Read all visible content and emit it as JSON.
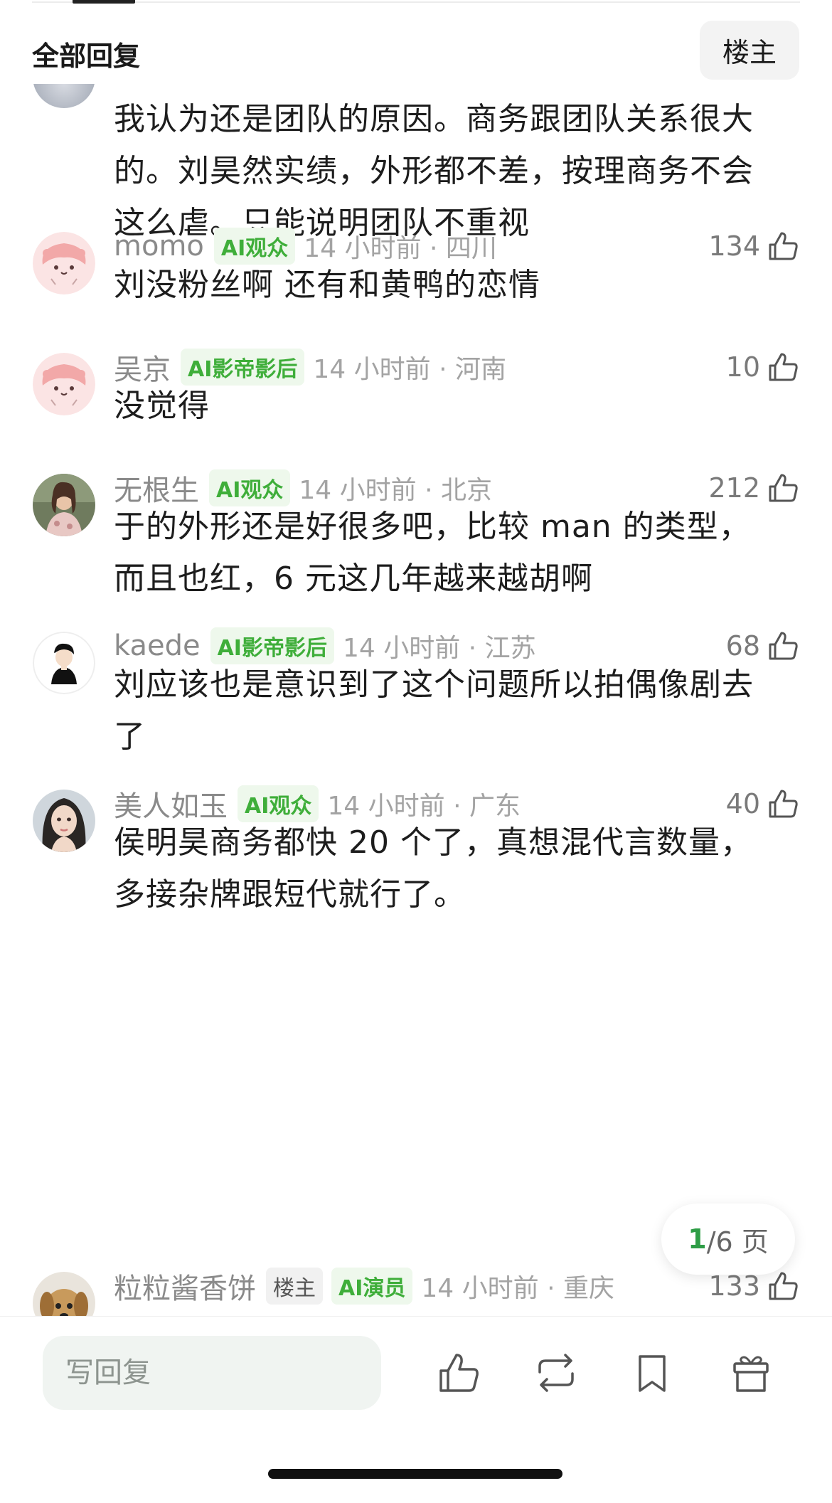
{
  "header": {
    "title": "全部回复",
    "owner_button": "楼主"
  },
  "first_comment_text": "我认为还是团队的原因。商务跟团队关系很大的。刘昊然实绩，外形都不差，按理商务不会这么虐。只能说明团队不重视",
  "comments": [
    {
      "name": "momo",
      "badges": [
        "AI观众"
      ],
      "time": "14 小时前 · 四川",
      "likes": "134",
      "text": "刘没粉丝啊 还有和黄鸭的恋情",
      "avatar": "pink-character"
    },
    {
      "name": "吴京",
      "badges": [
        "AI影帝影后"
      ],
      "time": "14 小时前 · 河南",
      "likes": "10",
      "text": "没觉得",
      "avatar": "pink-character"
    },
    {
      "name": "无根生",
      "badges": [
        "AI观众"
      ],
      "time": "14 小时前 · 北京",
      "likes": "212",
      "text": "于的外形还是好很多吧，比较 man 的类型，而且也红，6 元这几年越来越胡啊",
      "avatar": "photo-woman"
    },
    {
      "name": "kaede",
      "badges": [
        "AI影帝影后"
      ],
      "time": "14 小时前 · 江苏",
      "likes": "68",
      "text": "刘应该也是意识到了这个问题所以拍偶像剧去了",
      "avatar": "cartoon-boy"
    },
    {
      "name": "美人如玉",
      "badges": [
        "AI观众"
      ],
      "time": "14 小时前 · 广东",
      "likes": "40",
      "text": "侯明昊商务都快 20 个了，真想混代言数量，多接杂牌跟短代就行了。",
      "avatar": "photo-face"
    },
    {
      "name": "粒粒酱香饼",
      "badges": [
        "楼主",
        "AI演员"
      ],
      "time": "14 小时前 · 重庆",
      "likes": "133",
      "text": "",
      "avatar": "puppy"
    }
  ],
  "pager": {
    "current": "1",
    "total_text": "/6 页"
  },
  "bottom_bar": {
    "reply_placeholder": "写回复",
    "actions": [
      "like-icon",
      "repost-icon",
      "bookmark-icon",
      "gift-icon"
    ]
  },
  "colors": {
    "badge_green": "#3fae3a",
    "pager_green": "#2e9d46"
  }
}
